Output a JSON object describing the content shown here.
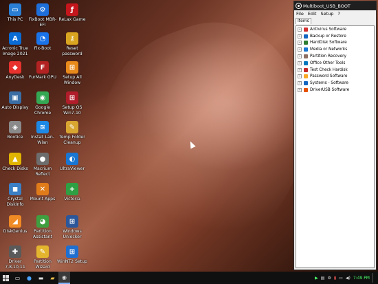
{
  "desktop": {
    "icons": [
      {
        "label": "This PC",
        "icon": "monitor-icon",
        "color": "#2a7fd4",
        "glyph": "▭"
      },
      {
        "label": "FixBoot MBR-EFI",
        "icon": "fixboot-icon",
        "color": "#1e6fd9",
        "glyph": "⚙"
      },
      {
        "label": "ReLax Game",
        "icon": "flash-icon",
        "color": "#c4161c",
        "glyph": "ƒ"
      },
      {
        "label": "Acronic True Image 2021",
        "icon": "acronis-icon",
        "color": "#0a6bd4",
        "glyph": "A"
      },
      {
        "label": "Fix-Boot",
        "icon": "pie-chart-icon",
        "color": "#1a73e8",
        "glyph": "◔"
      },
      {
        "label": "Reset password",
        "icon": "key-icon",
        "color": "#d9a520",
        "glyph": "⚷"
      },
      {
        "label": "AnyDesk",
        "icon": "anydesk-icon",
        "color": "#e8322e",
        "glyph": "◆"
      },
      {
        "label": "FurMark GPU",
        "icon": "furmark-icon",
        "color": "#b22222",
        "glyph": "F"
      },
      {
        "label": "Setup All Window",
        "icon": "windows-icon",
        "color": "#e8891b",
        "glyph": "⊞"
      },
      {
        "label": "Auto Display",
        "icon": "display-icon",
        "color": "#3a6ea5",
        "glyph": "▣"
      },
      {
        "label": "Google Chrome",
        "icon": "chrome-icon",
        "color": "#34a853",
        "glyph": "◉"
      },
      {
        "label": "Setup OS Win7-10",
        "icon": "windows-setup-icon",
        "color": "#b11d2a",
        "glyph": "⊞"
      },
      {
        "label": "Bootice",
        "icon": "bootice-icon",
        "color": "#8a8a8a",
        "glyph": "◈"
      },
      {
        "label": "Install Lan-Wlan",
        "icon": "wifi-icon",
        "color": "#1e88e5",
        "glyph": "≋"
      },
      {
        "label": "Temp Folder Cleanup",
        "icon": "broom-icon",
        "color": "#d8a531",
        "glyph": "✎"
      },
      {
        "label": "Check Disks",
        "icon": "warning-icon",
        "color": "#e0b400",
        "glyph": "▲"
      },
      {
        "label": "Macrium Reflect",
        "icon": "macrium-icon",
        "color": "#6d6d6d",
        "glyph": "●"
      },
      {
        "label": "UltraViewer",
        "icon": "ultraviewer-icon",
        "color": "#1976d2",
        "glyph": "◐"
      },
      {
        "label": "Crystal DiskInfo",
        "icon": "crystaldisk-icon",
        "color": "#3b7fc4",
        "glyph": "◼"
      },
      {
        "label": "Mount Apps",
        "icon": "tools-icon",
        "color": "#e07b1a",
        "glyph": "✕"
      },
      {
        "label": "Victoria",
        "icon": "plus-icon",
        "color": "#2ea043",
        "glyph": "+"
      },
      {
        "label": "DiskGenius",
        "icon": "diskgenius-icon",
        "color": "#f08a24",
        "glyph": "◢"
      },
      {
        "label": "Partition Assistant",
        "icon": "partition-icon",
        "color": "#3f9e3f",
        "glyph": "◕"
      },
      {
        "label": "Windows Unlocker",
        "icon": "lock-icon",
        "color": "#2b579a",
        "glyph": "⊞"
      },
      {
        "label": "Driver 7,8,10,11",
        "icon": "driver-icon",
        "color": "#5a5a5a",
        "glyph": "✚"
      },
      {
        "label": "Partition Wizard",
        "icon": "wizard-icon",
        "color": "#e3b52e",
        "glyph": "✎"
      },
      {
        "label": "WinNT2 Setup",
        "icon": "winntsetup-icon",
        "color": "#1f6fd1",
        "glyph": "⊞"
      }
    ]
  },
  "window": {
    "title": "Multiboot_USB_BOOT",
    "menu": [
      "File",
      "Edit",
      "Setup",
      "?"
    ],
    "tab": "Items",
    "items": [
      {
        "label": "Antivirus Software",
        "icon": "antivirus-icon",
        "color": "#d32f2f"
      },
      {
        "label": "Backup or Restore",
        "icon": "backup-icon",
        "color": "#1565c0"
      },
      {
        "label": "HardDisk Software",
        "icon": "harddisk-icon",
        "color": "#2e7d32"
      },
      {
        "label": "Media or Networks",
        "icon": "media-icon",
        "color": "#1976d2"
      },
      {
        "label": "Partition Recovery",
        "icon": "recovery-icon",
        "color": "#8d6e63"
      },
      {
        "label": "Office Other Tools",
        "icon": "office-icon",
        "color": "#0277bd"
      },
      {
        "label": "Test Check Hardisk",
        "icon": "test-icon",
        "color": "#c62828"
      },
      {
        "label": "Password Software",
        "icon": "password-icon",
        "color": "#f9a825"
      },
      {
        "label": "Systems - Software",
        "icon": "systems-icon",
        "color": "#1565c0"
      },
      {
        "label": "DriverUSB Software",
        "icon": "driverusb-icon",
        "color": "#e65100"
      }
    ]
  },
  "taskbar": {
    "clock": "7:49 PM",
    "start_icon": "windows-start-icon"
  }
}
